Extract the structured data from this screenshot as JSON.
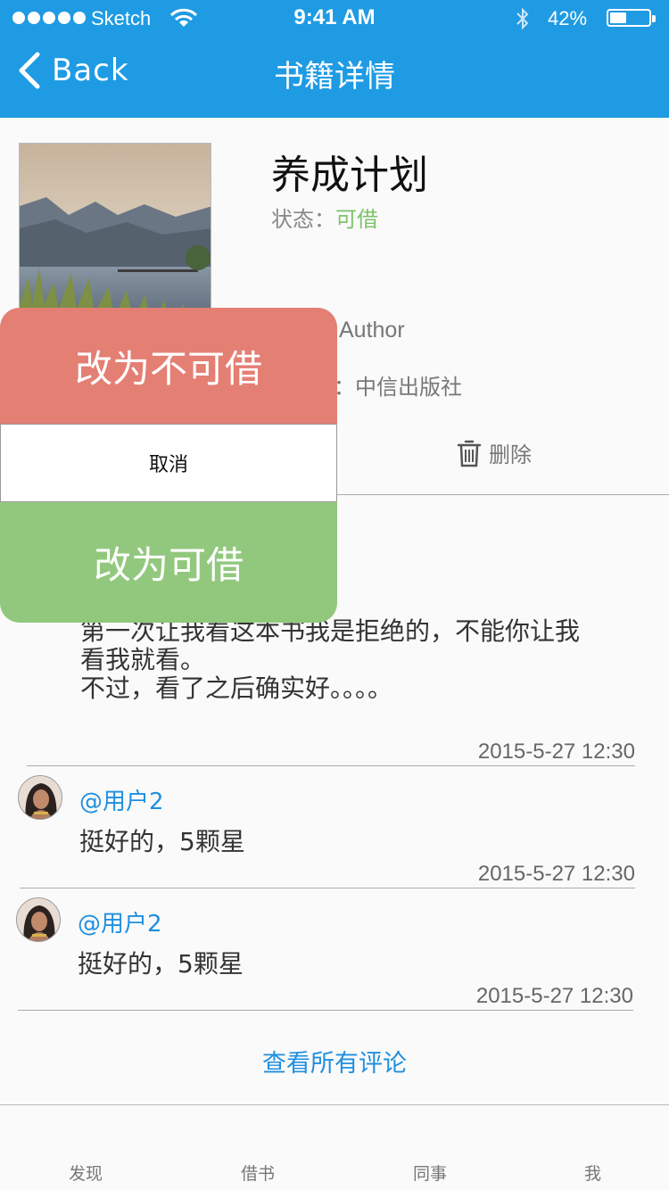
{
  "status_bar": {
    "carrier": "Sketch",
    "time": "9:41 AM",
    "battery": "42%"
  },
  "nav": {
    "back_label": "Back",
    "title": "书籍详情"
  },
  "book": {
    "title": "养成计划",
    "status_label": "状态：",
    "status_value": "可借",
    "author_partial": "Author",
    "publisher_partial": "：中信出版社",
    "delete_label": "删除"
  },
  "comments": [
    {
      "text": "第一次让我看这本书我是拒绝的，不能你让我\n看我就看。\n不过，看了之后确实好。。。。",
      "time": "2015-5-27 12:30"
    },
    {
      "user": "@用户2",
      "text": "挺好的，5颗星",
      "time": "2015-5-27 12:30"
    },
    {
      "user": "@用户2",
      "text": "挺好的，5颗星",
      "time": "2015-5-27 12:30"
    }
  ],
  "see_all_label": "查看所有评论",
  "tabs": [
    "发现",
    "借书",
    "同事",
    "我"
  ],
  "action_sheet": {
    "set_unavailable": "改为不可借",
    "cancel": "取消",
    "set_available": "改为可借"
  },
  "colors": {
    "nav_blue": "#1f9be3",
    "available_green": "#7dc26a",
    "unavailable_red": "#e47f74",
    "link_blue": "#1f8fe0"
  }
}
